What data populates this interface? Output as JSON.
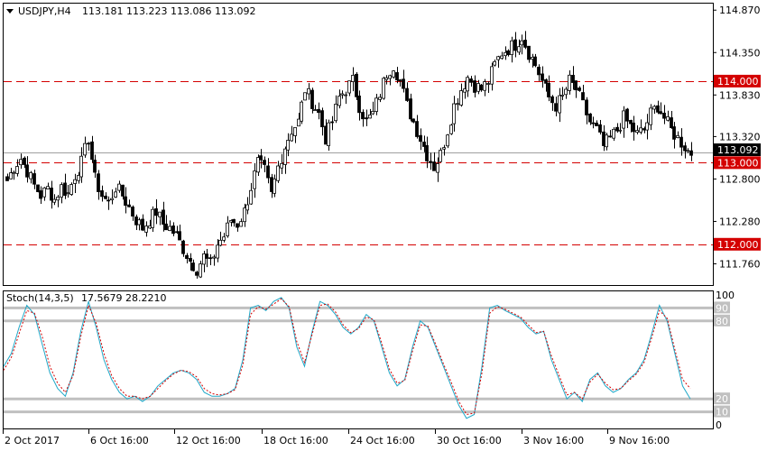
{
  "header": {
    "symbol_timeframe": "USDJPY,H4",
    "ohlc": "113.181 113.223 113.086 113.092"
  },
  "stoch_header": {
    "label": "Stoch(14,3,5)",
    "values": "17.5679 28.2210"
  },
  "colors": {
    "candle": "#000000",
    "level_line": "#d40000",
    "level_label_bg": "#d40000",
    "level_label_text": "#ffffff",
    "current_label_bg": "#000000",
    "stoch_main": "#20a8c8",
    "stoch_signal": "#d40000",
    "stoch_band": "#c0c0c0"
  },
  "chart_data": [
    {
      "type": "candlestick",
      "title": "USDJPY,H4",
      "ylim": [
        111.5,
        114.95
      ],
      "y_ticks": [
        "114.870",
        "114.350",
        "113.830",
        "113.320",
        "112.800",
        "112.280",
        "111.760"
      ],
      "x_ticks": [
        "2 Oct 2017",
        "6 Oct 16:00",
        "12 Oct 16:00",
        "18 Oct 16:00",
        "24 Oct 16:00",
        "30 Oct 16:00",
        "3 Nov 16:00",
        "9 Nov 16:00"
      ],
      "level_labels": [
        "114.000",
        "113.000",
        "112.000"
      ],
      "current_price_label": "113.092",
      "close_path": [
        112.78,
        112.95,
        113.05,
        112.9,
        112.72,
        112.6,
        112.68,
        112.55,
        112.7,
        112.62,
        112.85,
        113.0,
        113.3,
        112.8,
        112.6,
        112.5,
        112.7,
        112.6,
        112.45,
        112.3,
        112.2,
        112.3,
        112.4,
        112.25,
        112.2,
        112.1,
        111.95,
        111.8,
        111.7,
        111.85,
        111.75,
        112.0,
        112.1,
        112.3,
        112.25,
        112.4,
        112.7,
        113.0,
        112.9,
        112.6,
        112.95,
        113.2,
        113.4,
        113.5,
        113.9,
        113.75,
        113.6,
        113.3,
        113.5,
        113.8,
        113.9,
        114.0,
        113.7,
        113.5,
        113.6,
        113.85,
        114.1,
        114.2,
        114.0,
        113.7,
        113.5,
        113.3,
        113.1,
        112.95,
        113.1,
        113.4,
        113.7,
        113.9,
        114.05,
        113.95,
        113.9,
        114.0,
        114.2,
        114.35,
        114.4,
        114.45,
        114.55,
        114.35,
        114.2,
        114.0,
        113.8,
        113.7,
        113.8,
        114.0,
        113.9,
        113.7,
        113.5,
        113.4,
        113.2,
        113.3,
        113.4,
        113.55,
        113.45,
        113.35,
        113.4,
        113.6,
        113.7,
        113.55,
        113.4,
        113.3,
        113.2,
        113.09
      ],
      "levels": [
        114.0,
        113.0,
        112.0
      ],
      "current_price": 113.092,
      "current_line_price": 113.12
    },
    {
      "type": "line",
      "title": "Stoch(14,3,5)",
      "ylim": [
        0,
        100
      ],
      "y_ticks": [
        "100",
        "90",
        "80",
        "20",
        "10",
        "0"
      ],
      "band_levels": [
        90,
        80,
        20,
        10
      ],
      "series": [
        {
          "name": "main",
          "values": [
            45,
            55,
            75,
            92,
            85,
            62,
            40,
            28,
            22,
            40,
            72,
            95,
            75,
            50,
            35,
            25,
            20,
            22,
            18,
            22,
            30,
            35,
            40,
            42,
            40,
            35,
            25,
            22,
            22,
            24,
            28,
            50,
            90,
            92,
            88,
            95,
            98,
            90,
            60,
            45,
            72,
            95,
            92,
            85,
            75,
            70,
            75,
            85,
            80,
            60,
            40,
            30,
            35,
            60,
            80,
            75,
            60,
            45,
            30,
            15,
            5,
            8,
            45,
            90,
            92,
            88,
            85,
            82,
            75,
            70,
            72,
            50,
            35,
            20,
            25,
            18,
            35,
            40,
            30,
            25,
            28,
            35,
            40,
            50,
            70,
            92,
            80,
            55,
            30,
            20
          ]
        },
        {
          "name": "signal",
          "values": [
            42,
            52,
            70,
            88,
            86,
            68,
            45,
            32,
            25,
            38,
            68,
            92,
            78,
            55,
            38,
            28,
            22,
            22,
            20,
            22,
            28,
            34,
            39,
            42,
            41,
            37,
            28,
            24,
            23,
            24,
            27,
            46,
            85,
            91,
            89,
            93,
            97,
            91,
            64,
            48,
            70,
            92,
            93,
            87,
            77,
            71,
            74,
            83,
            81,
            63,
            43,
            32,
            34,
            57,
            77,
            76,
            62,
            47,
            33,
            18,
            8,
            9,
            40,
            86,
            91,
            89,
            86,
            83,
            77,
            71,
            72,
            53,
            38,
            23,
            25,
            20,
            33,
            39,
            32,
            27,
            28,
            34,
            39,
            48,
            67,
            88,
            82,
            58,
            35,
            28
          ]
        }
      ]
    }
  ]
}
